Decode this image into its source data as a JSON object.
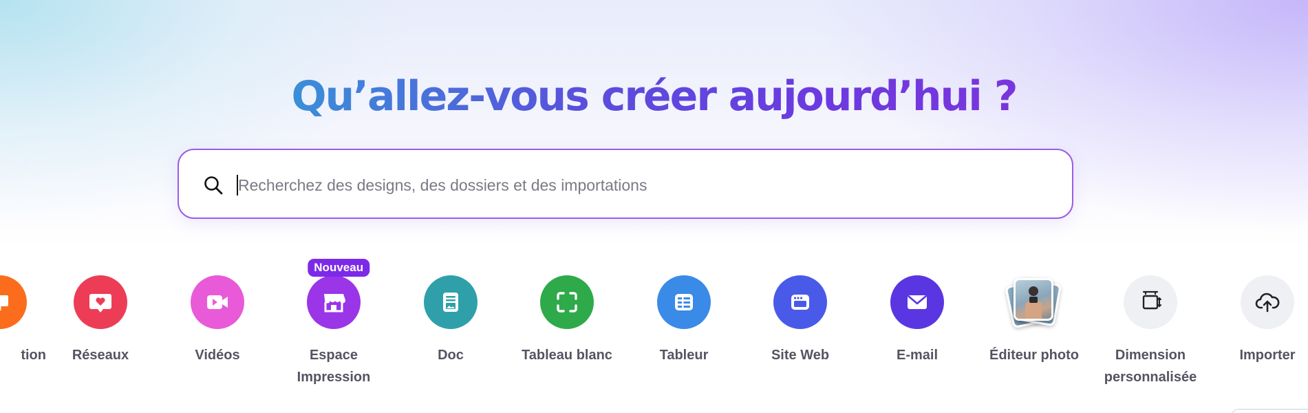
{
  "hero": {
    "title": "Qu’allez-vous créer aujourd’hui ?"
  },
  "search": {
    "placeholder": "Recherchez des designs, des dossiers et des importations",
    "value": ""
  },
  "categories": [
    {
      "label": "tion",
      "icon": "presentation-icon",
      "color": "#fb6d1c"
    },
    {
      "label": "Réseaux",
      "icon": "heart-bubble-icon",
      "color": "#ed3d56"
    },
    {
      "label": "Vidéos",
      "icon": "video-camera-icon",
      "color": "#e95ad8"
    },
    {
      "label_line1": "Espace",
      "label_line2": "Impression",
      "icon": "storefront-icon",
      "color": "#9a35e8",
      "badge": "Nouveau"
    },
    {
      "label": "Doc",
      "icon": "document-icon",
      "color": "#2fa0aa"
    },
    {
      "label": "Tableau blanc",
      "icon": "whiteboard-icon",
      "color": "#2faa4a"
    },
    {
      "label": "Tableur",
      "icon": "spreadsheet-icon",
      "color": "#3a8ae8"
    },
    {
      "label": "Site Web",
      "icon": "website-icon",
      "color": "#4a5ae8"
    },
    {
      "label": "E-mail",
      "icon": "envelope-icon",
      "color": "#5a36e2"
    },
    {
      "label": "Éditeur photo",
      "icon": "photo-stack-icon"
    },
    {
      "label_line1": "Dimension",
      "label_line2": "personnalisée",
      "icon": "custom-size-icon",
      "color": "#eef0f3"
    },
    {
      "label": "Importer",
      "icon": "cloud-upload-icon",
      "color": "#eef0f3"
    }
  ]
}
